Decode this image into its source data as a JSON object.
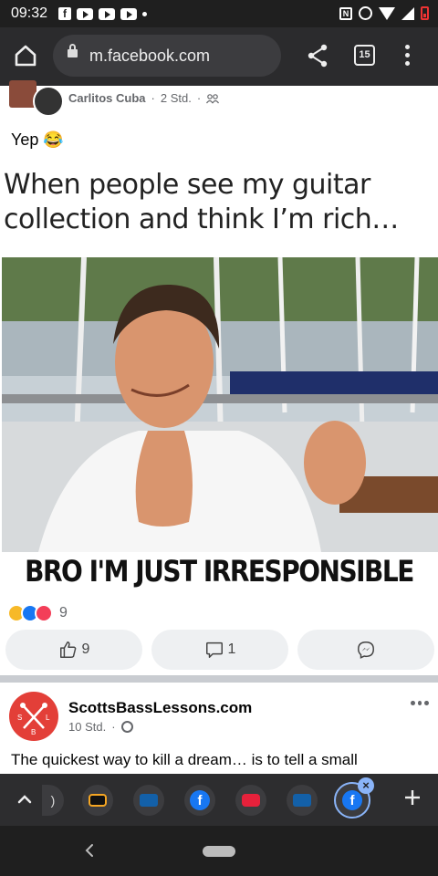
{
  "status_bar": {
    "time": "09:32",
    "nfc_badge": "N"
  },
  "browser": {
    "url": "m.facebook.com",
    "tab_count": "15"
  },
  "post1": {
    "author": "Carlitos Cuba",
    "time": "2 Std.",
    "separator": "·",
    "text": "Yep 😂",
    "meme_caption_line1": "When people see my guitar",
    "meme_caption_line2": "collection and think I’m rich…",
    "meme_bottom_text": "BRO I'M JUST IRRESPONSIBLE",
    "reaction_count": "9",
    "like_count": "9",
    "comment_count": "1"
  },
  "post2": {
    "author": "ScottsBassLessons.com",
    "time": "10 Std.",
    "separator": "·",
    "avatar_letters": {
      "s": "S",
      "l": "L",
      "b": "B"
    },
    "text": "The quickest way to kill a dream… is to tell a small"
  },
  "tab_strip": {
    "tabs": [
      "partial-tab",
      "bandcamp",
      "volksbank",
      "facebook",
      "red-app",
      "volksbank",
      "facebook-active"
    ],
    "fb_letter": "f"
  },
  "colors": {
    "facebook_blue": "#1877f2",
    "browser_bar": "#2b2b2d",
    "reaction_haha": "#f7b928",
    "reaction_love": "#f33e58",
    "scotts_red": "#e33f38",
    "tab_active_ring": "#8ab4f8"
  }
}
